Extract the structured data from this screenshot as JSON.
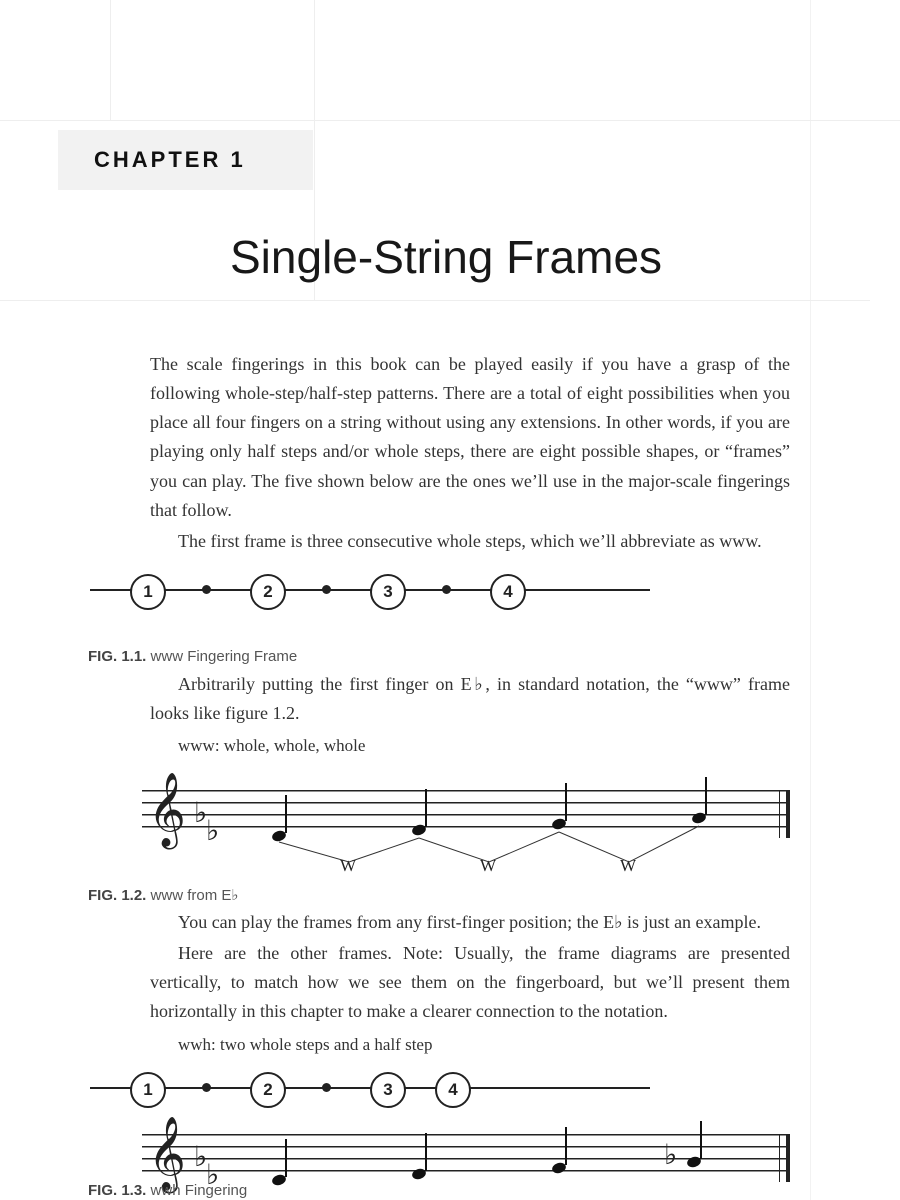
{
  "chapter_label": "CHAPTER 1",
  "title": "Single-String Frames",
  "p1": "The scale fingerings in this book can be played easily if you have a grasp of the following whole-step/half-step patterns. There are a total of eight possibilities when you place all four fingers on a string without using any extensions. In other words, if you are playing only half steps and/or whole steps, there are eight possible shapes, or “frames” you can play. The five shown below are the ones we’ll use in the major-scale fingerings that follow.",
  "p2": "The first frame is three consecutive whole steps, which we’ll abbreviate as www.",
  "fig11": "FIG. 1.1.",
  "fig11_t": " www Fingering Frame",
  "p3": "Arbitrarily putting the first finger on E♭, in standard notation, the “www” frame looks like figure 1.2.",
  "p3b": "www: whole, whole, whole",
  "fig12": "FIG. 1.2.",
  "fig12_t": " www from E♭",
  "p4": "You can play the frames from any first-finger position; the E♭ is just an example.",
  "p5": "Here are the other frames. Note: Usually, the frame diagrams are presented vertically, to match how we see them on the fingerboard, but we’ll present them horizontally in this chapter to make a clearer connection to the notation.",
  "p5b": "wwh: two whole steps and a half step",
  "fig13": "FIG. 1.3.",
  "fig13_t": " wwh Fingering",
  "frame_www": {
    "nodes": [
      1,
      2,
      3,
      4
    ],
    "gaps": [
      "w",
      "w",
      "w"
    ]
  },
  "frame_wwh": {
    "nodes": [
      1,
      2,
      3,
      4
    ],
    "gaps": [
      "w",
      "w",
      "h"
    ]
  },
  "w_label": "W"
}
